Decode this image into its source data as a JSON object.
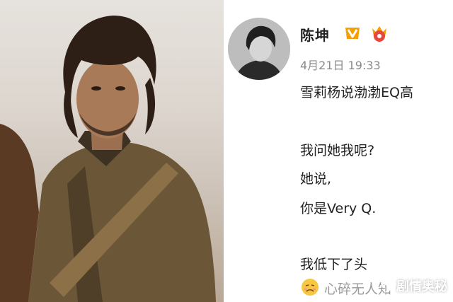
{
  "user": {
    "name": "陈坤",
    "timestamp": "4月21日 19:33"
  },
  "post": {
    "lines": [
      "雪莉杨说渤渤EQ高",
      "我问她我呢?",
      "她说,",
      "你是Very Q.",
      "我低下了头",
      "心碎无人知"
    ]
  },
  "watermark": {
    "text": "剧情奥秘"
  },
  "colors": {
    "name": "#222222",
    "timestamp": "#8a8a8a",
    "vip_badge": "#f5a000",
    "level_badge": "#e8453c"
  },
  "icons": [
    "avatar",
    "vip-badge-icon",
    "level-badge-icon",
    "sad-face-emoji-icon",
    "watermark-logo-icon"
  ]
}
